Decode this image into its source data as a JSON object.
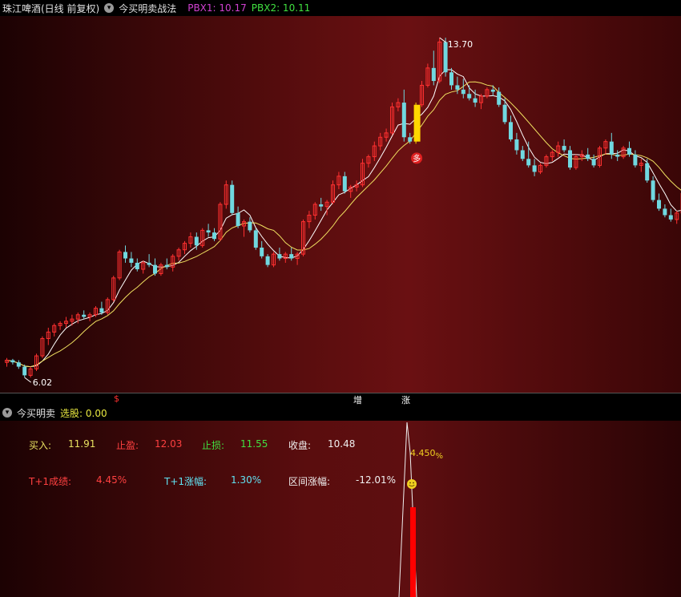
{
  "header": {
    "title": "珠江啤酒(日线 前复权)",
    "indicator_name": "今买明卖战法",
    "pbx1_label": "PBX1: 10.17",
    "pbx2_label": "PBX2: 10.11",
    "dropdown_icon": "chevron-down-icon",
    "colors": {
      "pbx1": "#d040d0",
      "pbx2": "#40e040",
      "title": "#e0e0e0"
    }
  },
  "sub_header": {
    "indicator_name": "今买明卖",
    "select_label": "选股: 0.00",
    "select_color": "#e8e840"
  },
  "axis_markers": [
    {
      "text": "$",
      "color": "#ff3030"
    },
    {
      "text": "增",
      "color": "#ffffff"
    },
    {
      "text": "涨",
      "color": "#ffffff"
    }
  ],
  "stats": {
    "buy_label": "买入:",
    "buy_value": "11.91",
    "take_profit_label": "止盈:",
    "take_profit_value": "12.03",
    "stop_loss_label": "止损:",
    "stop_loss_value": "11.55",
    "close_label": "收盘:",
    "close_value": "10.48",
    "t1_result_label": "T+1成绩:",
    "t1_result_value": "4.45%",
    "t1_change_label": "T+1涨幅:",
    "t1_change_value": "1.30%",
    "range_change_label": "区间涨幅:",
    "range_change_value": "-12.01%",
    "spike_label": "4.450",
    "spike_unit": "%",
    "smiley_icon": "smiley-icon"
  },
  "chart_data": {
    "type": "candlestick",
    "title": "珠江啤酒(日线 前复权)",
    "annotations": {
      "high_label": "13.70",
      "low_label": "6.02",
      "buy_marker": "多"
    },
    "ylim": [
      5.5,
      14.2
    ],
    "colors": {
      "up": "#ff3030",
      "down": "#70d8e0",
      "ma_fast": "#ffffff",
      "ma_slow": "#f0e060",
      "highlight": "#ffd700"
    },
    "candles": [
      [
        6.2,
        6.3,
        6.1,
        6.25
      ],
      [
        6.25,
        6.28,
        6.15,
        6.2
      ],
      [
        6.2,
        6.25,
        6.05,
        6.1
      ],
      [
        6.1,
        6.15,
        5.85,
        5.9
      ],
      [
        5.9,
        6.1,
        5.85,
        6.05
      ],
      [
        6.05,
        6.4,
        6.0,
        6.35
      ],
      [
        6.35,
        6.8,
        6.3,
        6.75
      ],
      [
        6.75,
        7.0,
        6.6,
        6.9
      ],
      [
        6.9,
        7.1,
        6.8,
        7.05
      ],
      [
        7.05,
        7.15,
        6.95,
        7.1
      ],
      [
        7.1,
        7.25,
        7.0,
        7.15
      ],
      [
        7.15,
        7.3,
        7.05,
        7.2
      ],
      [
        7.2,
        7.35,
        7.1,
        7.3
      ],
      [
        7.3,
        7.4,
        7.2,
        7.25
      ],
      [
        7.25,
        7.35,
        7.15,
        7.3
      ],
      [
        7.3,
        7.5,
        7.25,
        7.45
      ],
      [
        7.45,
        7.6,
        7.3,
        7.35
      ],
      [
        7.35,
        7.7,
        7.3,
        7.65
      ],
      [
        7.65,
        8.2,
        7.6,
        8.15
      ],
      [
        8.15,
        8.8,
        8.1,
        8.75
      ],
      [
        8.75,
        8.9,
        8.5,
        8.6
      ],
      [
        8.6,
        8.75,
        8.4,
        8.5
      ],
      [
        8.5,
        8.6,
        8.3,
        8.35
      ],
      [
        8.35,
        8.55,
        8.25,
        8.5
      ],
      [
        8.5,
        8.7,
        8.4,
        8.45
      ],
      [
        8.45,
        8.6,
        8.2,
        8.25
      ],
      [
        8.25,
        8.5,
        8.2,
        8.45
      ],
      [
        8.45,
        8.6,
        8.35,
        8.4
      ],
      [
        8.4,
        8.7,
        8.3,
        8.65
      ],
      [
        8.65,
        8.85,
        8.55,
        8.8
      ],
      [
        8.8,
        9.0,
        8.7,
        8.95
      ],
      [
        8.95,
        9.2,
        8.85,
        9.1
      ],
      [
        9.1,
        9.2,
        8.8,
        8.9
      ],
      [
        8.9,
        9.3,
        8.85,
        9.25
      ],
      [
        9.25,
        9.4,
        9.1,
        9.2
      ],
      [
        9.2,
        9.3,
        9.0,
        9.05
      ],
      [
        9.05,
        9.9,
        9.0,
        9.85
      ],
      [
        9.85,
        10.4,
        9.75,
        10.3
      ],
      [
        10.3,
        10.4,
        9.6,
        9.65
      ],
      [
        9.65,
        9.8,
        9.3,
        9.35
      ],
      [
        9.35,
        9.5,
        9.1,
        9.45
      ],
      [
        9.45,
        9.55,
        9.2,
        9.25
      ],
      [
        9.25,
        9.3,
        8.8,
        8.85
      ],
      [
        8.85,
        9.0,
        8.6,
        8.65
      ],
      [
        8.65,
        8.7,
        8.4,
        8.45
      ],
      [
        8.45,
        8.75,
        8.4,
        8.7
      ],
      [
        8.7,
        8.85,
        8.55,
        8.6
      ],
      [
        8.6,
        8.75,
        8.5,
        8.7
      ],
      [
        8.7,
        8.85,
        8.55,
        8.6
      ],
      [
        8.6,
        8.75,
        8.45,
        8.7
      ],
      [
        8.7,
        9.5,
        8.65,
        9.45
      ],
      [
        9.45,
        9.7,
        9.3,
        9.6
      ],
      [
        9.6,
        9.9,
        9.5,
        9.85
      ],
      [
        9.85,
        10.0,
        9.7,
        9.8
      ],
      [
        9.8,
        9.95,
        9.6,
        9.9
      ],
      [
        9.9,
        10.4,
        9.85,
        10.3
      ],
      [
        10.3,
        10.6,
        10.2,
        10.5
      ],
      [
        10.5,
        10.6,
        10.1,
        10.15
      ],
      [
        10.15,
        10.3,
        10.0,
        10.25
      ],
      [
        10.25,
        10.4,
        10.15,
        10.3
      ],
      [
        10.3,
        10.9,
        10.25,
        10.8
      ],
      [
        10.8,
        11.0,
        10.7,
        10.95
      ],
      [
        10.95,
        11.3,
        10.85,
        11.2
      ],
      [
        11.2,
        11.5,
        11.1,
        11.4
      ],
      [
        11.4,
        11.6,
        11.3,
        11.5
      ],
      [
        11.5,
        12.2,
        11.45,
        12.1
      ],
      [
        12.1,
        12.3,
        12.0,
        12.2
      ],
      [
        12.2,
        12.5,
        11.3,
        11.4
      ],
      [
        11.4,
        11.5,
        11.25,
        11.3
      ],
      [
        11.3,
        12.2,
        11.25,
        12.15
      ],
      [
        12.15,
        12.7,
        12.1,
        12.6
      ],
      [
        12.6,
        13.1,
        12.55,
        13.0
      ],
      [
        13.0,
        13.4,
        12.6,
        12.7
      ],
      [
        12.7,
        13.7,
        12.65,
        13.6
      ],
      [
        13.6,
        13.7,
        12.8,
        12.9
      ],
      [
        12.9,
        13.0,
        12.5,
        12.6
      ],
      [
        12.6,
        12.8,
        12.4,
        12.5
      ],
      [
        12.5,
        12.75,
        12.3,
        12.4
      ],
      [
        12.4,
        12.6,
        12.25,
        12.3
      ],
      [
        12.3,
        12.5,
        12.1,
        12.2
      ],
      [
        12.2,
        12.4,
        12.05,
        12.35
      ],
      [
        12.35,
        12.55,
        12.3,
        12.5
      ],
      [
        12.5,
        12.6,
        12.35,
        12.45
      ],
      [
        12.45,
        12.55,
        12.1,
        12.15
      ],
      [
        12.15,
        12.3,
        11.7,
        11.75
      ],
      [
        11.75,
        11.9,
        11.3,
        11.35
      ],
      [
        11.35,
        11.5,
        11.0,
        11.1
      ],
      [
        11.1,
        11.2,
        10.85,
        10.9
      ],
      [
        10.9,
        11.3,
        10.7,
        10.75
      ],
      [
        10.75,
        10.9,
        10.5,
        10.6
      ],
      [
        10.6,
        10.8,
        10.55,
        10.75
      ],
      [
        10.75,
        11.0,
        10.7,
        10.95
      ],
      [
        10.95,
        11.1,
        10.85,
        11.05
      ],
      [
        11.05,
        11.3,
        10.95,
        11.2
      ],
      [
        11.2,
        11.35,
        11.05,
        11.1
      ],
      [
        11.1,
        11.2,
        10.65,
        10.7
      ],
      [
        10.7,
        11.0,
        10.65,
        10.95
      ],
      [
        10.95,
        11.1,
        10.85,
        11.0
      ],
      [
        11.0,
        11.15,
        10.85,
        10.9
      ],
      [
        10.9,
        11.0,
        10.7,
        10.75
      ],
      [
        10.75,
        11.2,
        10.7,
        11.15
      ],
      [
        11.15,
        11.35,
        11.0,
        11.3
      ],
      [
        11.3,
        11.5,
        10.9,
        11.0
      ],
      [
        11.0,
        11.1,
        10.85,
        10.95
      ],
      [
        10.95,
        11.2,
        10.9,
        11.15
      ],
      [
        11.15,
        11.3,
        10.95,
        11.0
      ],
      [
        11.0,
        11.1,
        10.7,
        10.75
      ],
      [
        10.75,
        10.9,
        10.6,
        10.8
      ],
      [
        10.8,
        10.9,
        10.35,
        10.4
      ],
      [
        10.4,
        10.5,
        9.9,
        9.95
      ],
      [
        9.95,
        10.1,
        9.7,
        9.75
      ],
      [
        9.75,
        9.85,
        9.55,
        9.6
      ],
      [
        9.6,
        9.75,
        9.45,
        9.5
      ],
      [
        9.5,
        9.7,
        9.4,
        9.65
      ],
      [
        9.65,
        10.2,
        9.6,
        10.1
      ]
    ],
    "highlight_index": 69
  }
}
